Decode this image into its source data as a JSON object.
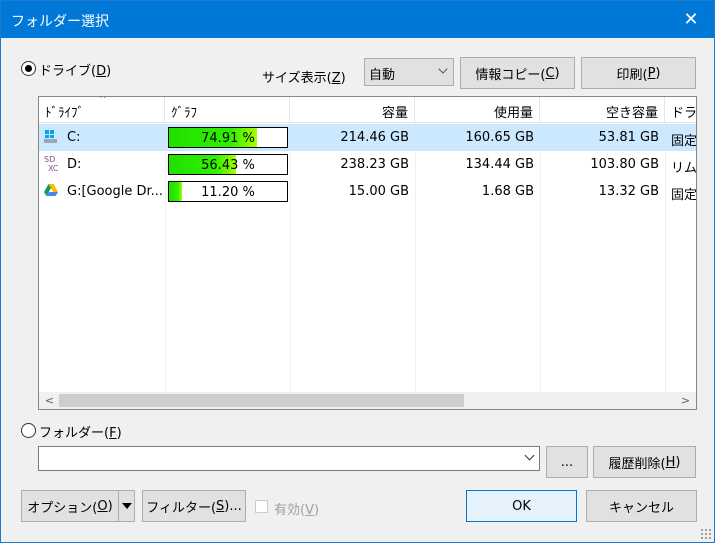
{
  "window": {
    "title": "フォルダー選択",
    "close_glyph": "✕"
  },
  "drive_radio": {
    "label_pre": "ドライブ(",
    "label_key": "D",
    "label_post": ")",
    "selected": true
  },
  "size_display": {
    "label_pre": "サイズ表示(",
    "label_key": "Z",
    "label_post": ")",
    "value": "自動"
  },
  "buttons": {
    "copy_info": {
      "pre": "情報コピー(",
      "key": "C",
      "post": ")"
    },
    "print": {
      "pre": "印刷(",
      "key": "P",
      "post": ")"
    },
    "browse": "...",
    "clear_history": {
      "pre": "履歴削除(",
      "key": "H",
      "post": ")"
    },
    "options": {
      "pre": "オプション(",
      "key": "O",
      "post": ")"
    },
    "filter": {
      "pre": "フィルター(",
      "key": "S",
      "post": ")..."
    },
    "ok": "OK",
    "cancel": "キャンセル"
  },
  "columns": [
    "ﾄﾞﾗｲﾌﾞ",
    "ｸﾞﾗﾌ",
    "容量",
    "使用量",
    "空き容量",
    "ドライ"
  ],
  "sort_indicator": "^",
  "drives": [
    {
      "name": "C:",
      "icon": "windows-drive-icon",
      "percent": 74.91,
      "percent_label": "74.91 %",
      "capacity": "214.46 GB",
      "used": "160.65 GB",
      "free": "53.81 GB",
      "type": "固定",
      "selected": true
    },
    {
      "name": "D:",
      "icon": "sdxc-card-icon",
      "percent": 56.43,
      "percent_label": "56.43 %",
      "capacity": "238.23 GB",
      "used": "134.44 GB",
      "free": "103.80 GB",
      "type": "リム-",
      "selected": false
    },
    {
      "name": "G:[Google Dr...",
      "icon": "google-drive-icon",
      "percent": 11.2,
      "percent_label": "11.20 %",
      "capacity": "15.00 GB",
      "used": "1.68 GB",
      "free": "13.32 GB",
      "type": "固定",
      "selected": false
    }
  ],
  "scroll": {
    "left": "<",
    "right": ">"
  },
  "folder_radio": {
    "label_pre": "フォルダー(",
    "label_key": "F",
    "label_post": ")",
    "selected": false
  },
  "folder_input": {
    "value": ""
  },
  "valid_checkbox": {
    "pre": "有効(",
    "key": "V",
    "post": ")",
    "checked": false
  },
  "colors": {
    "titlebar": "#0078d7",
    "selection": "#cce8ff",
    "bar_fill": "#30f000"
  }
}
